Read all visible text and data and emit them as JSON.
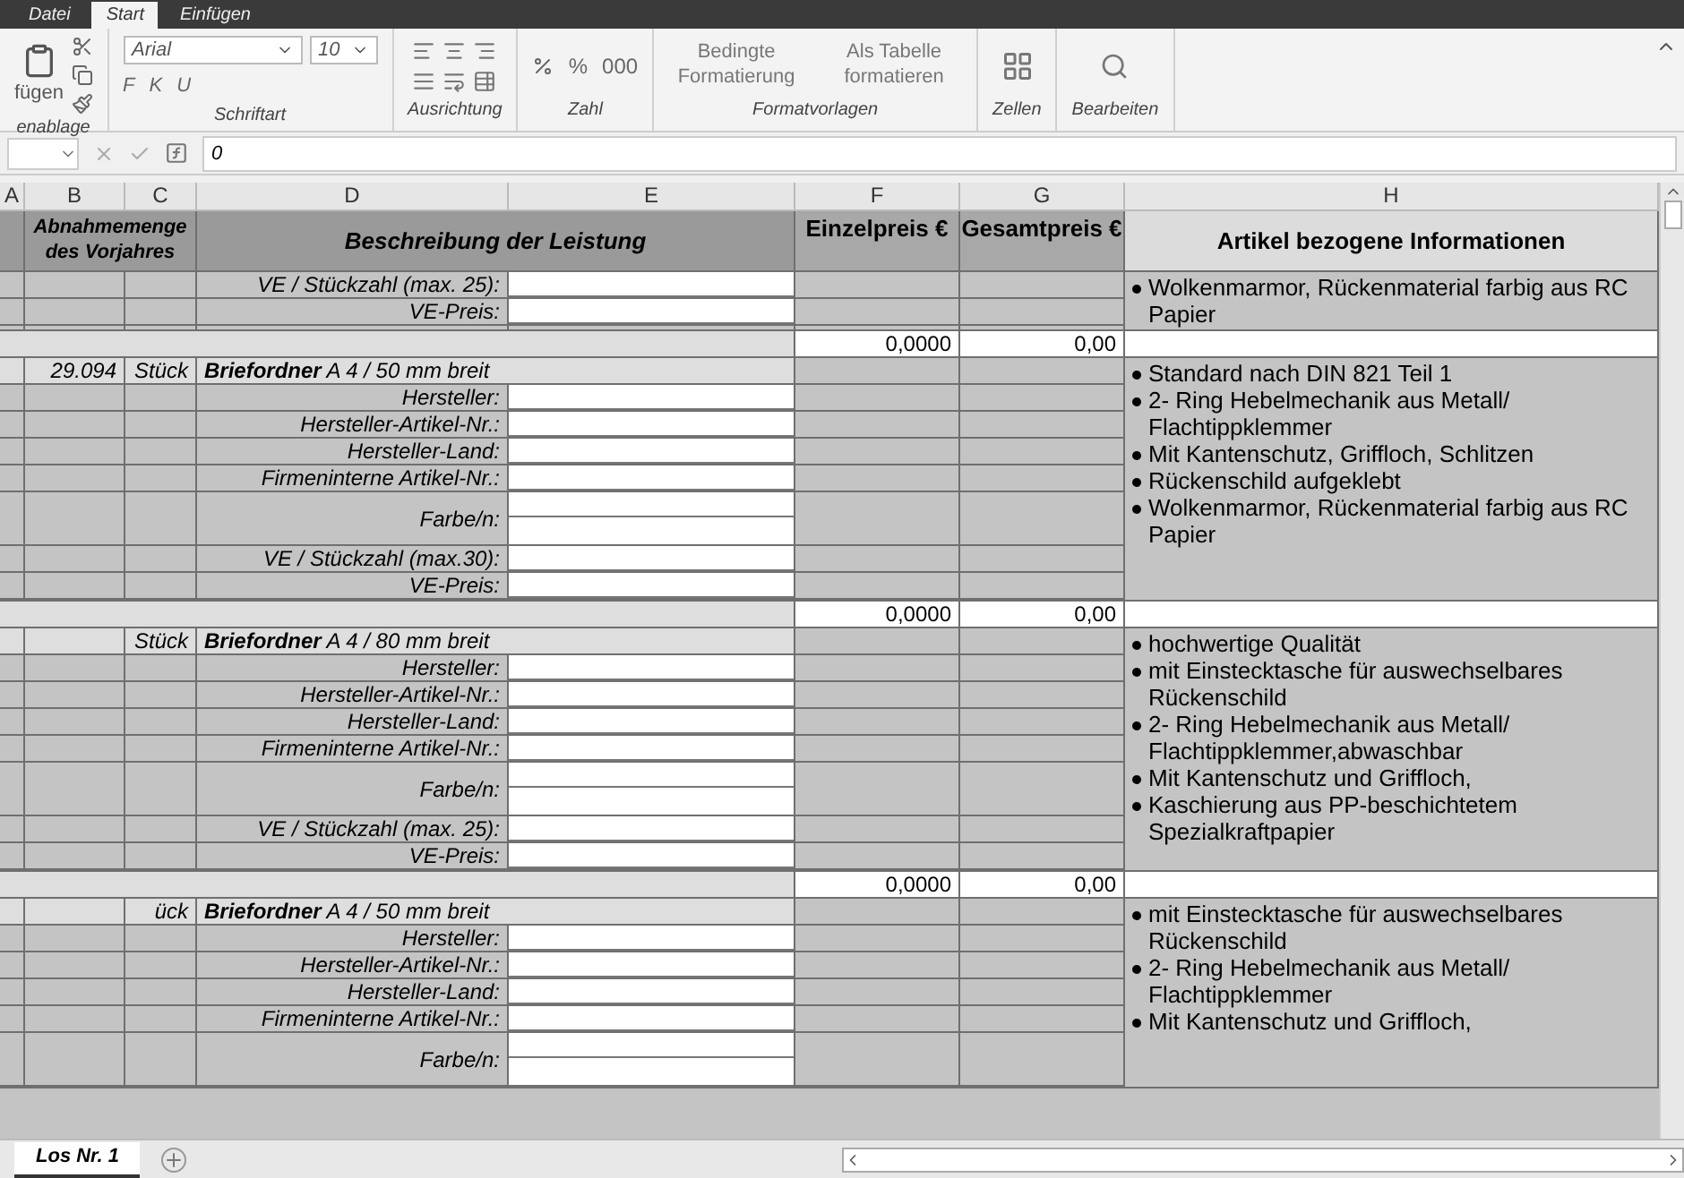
{
  "ribbon": {
    "tabs": [
      {
        "label": "Datei",
        "selected": false
      },
      {
        "label": "Start",
        "selected": true
      },
      {
        "label": "Einfügen",
        "selected": false
      }
    ],
    "groups": [
      {
        "kind": "clipboard",
        "label": "enablage",
        "button": "fügen"
      },
      {
        "kind": "font",
        "label": "Schriftart",
        "font": "Arial",
        "size": "10",
        "styles": [
          "F",
          "K",
          "U"
        ]
      },
      {
        "kind": "align",
        "label": "Ausrichtung"
      },
      {
        "kind": "number",
        "label": "Zahl",
        "items": [
          "%",
          "000"
        ]
      },
      {
        "kind": "styles",
        "label": "Formatvorlagen",
        "buttons": [
          "Bedingte Formatierung",
          "Als Tabelle formatieren"
        ]
      },
      {
        "kind": "cells",
        "label": "Zellen"
      },
      {
        "kind": "editing",
        "label": "Bearbeiten"
      }
    ]
  },
  "formula_bar": {
    "value": "0"
  },
  "columns": [
    "A",
    "B",
    "C",
    "D",
    "E",
    "F",
    "G",
    "H"
  ],
  "header": {
    "quantity": "Abnahmemenge des Vorjahres",
    "description": "Beschreibung der Leistung",
    "unit_price": "Einzelpreis €",
    "total_price": "Gesamtpreis €",
    "info": "Artikel bezogene Informationen"
  },
  "blocks": [
    {
      "rows": [
        {
          "kind": "field",
          "label": "VE / Stückzahl (max. 25):"
        },
        {
          "kind": "field",
          "label": "VE-Preis:"
        }
      ],
      "info": [
        "Wolkenmarmor, Rückenmaterial farbig aus RC Papier"
      ],
      "price": {
        "unit_price": "0,0000",
        "total_price": "0,00"
      }
    },
    {
      "rows": [
        {
          "kind": "title",
          "quantity": "29.094",
          "unit": "Stück",
          "text": "**Briefordner** A 4 / 50 mm breit"
        },
        {
          "kind": "field",
          "label": "Hersteller:"
        },
        {
          "kind": "field",
          "label": "Hersteller-Artikel-Nr.:"
        },
        {
          "kind": "field",
          "label": "Hersteller-Land:"
        },
        {
          "kind": "field",
          "label": "Firmeninterne Artikel-Nr.:"
        },
        {
          "kind": "tall_field",
          "label": "Farbe/n:"
        },
        {
          "kind": "field",
          "label": "VE / Stückzahl (max.30):"
        },
        {
          "kind": "field",
          "label": "VE-Preis:"
        }
      ],
      "info": [
        "Standard nach DIN 821 Teil 1",
        "2- Ring Hebelmechanik aus Metall/ Flachtippklemmer",
        "Mit Kantenschutz, Griffloch, Schlitzen",
        "Rückenschild aufgeklebt",
        "Wolkenmarmor, Rückenmaterial farbig aus RC Papier"
      ],
      "price": {
        "unit_price": "0,0000",
        "total_price": "0,00"
      }
    },
    {
      "rows": [
        {
          "kind": "title",
          "unit": "Stück",
          "text": "**Briefordner** A 4 / 80 mm breit"
        },
        {
          "kind": "field",
          "label": "Hersteller:"
        },
        {
          "kind": "field",
          "label": "Hersteller-Artikel-Nr.:"
        },
        {
          "kind": "field",
          "label": "Hersteller-Land:"
        },
        {
          "kind": "field",
          "label": "Firmeninterne Artikel-Nr.:"
        },
        {
          "kind": "tall_field",
          "label": "Farbe/n:"
        },
        {
          "kind": "field",
          "label": "VE / Stückzahl (max. 25):"
        },
        {
          "kind": "field",
          "label": "VE-Preis:"
        }
      ],
      "info": [
        "hochwertige Qualität",
        "mit Einstecktasche für auswechselbares Rückenschild",
        "2- Ring Hebelmechanik aus Metall/ Flachtippklemmer,abwaschbar",
        "Mit Kantenschutz und Griffloch,",
        "Kaschierung aus PP-beschichtetem Spezialkraftpapier"
      ],
      "price": {
        "unit_price": "0,0000",
        "total_price": "0,00"
      }
    },
    {
      "rows": [
        {
          "kind": "title",
          "unit": "ück",
          "text": "**Briefordner** A 4 / 50 mm breit"
        },
        {
          "kind": "field",
          "label": "Hersteller:"
        },
        {
          "kind": "field",
          "label": "Hersteller-Artikel-Nr.:"
        },
        {
          "kind": "field",
          "label": "Hersteller-Land:"
        },
        {
          "kind": "field",
          "label": "Firmeninterne Artikel-Nr.:"
        },
        {
          "kind": "tall_field",
          "label": "Farbe/n:"
        }
      ],
      "info": [
        "mit Einstecktasche für auswechselbares Rückenschild",
        "2- Ring Hebelmechanik aus Metall/ Flachtippklemmer",
        "Mit Kantenschutz und Griffloch,"
      ]
    }
  ],
  "sheet_tabs": [
    {
      "label": "Los Nr. 1",
      "selected": true
    }
  ]
}
